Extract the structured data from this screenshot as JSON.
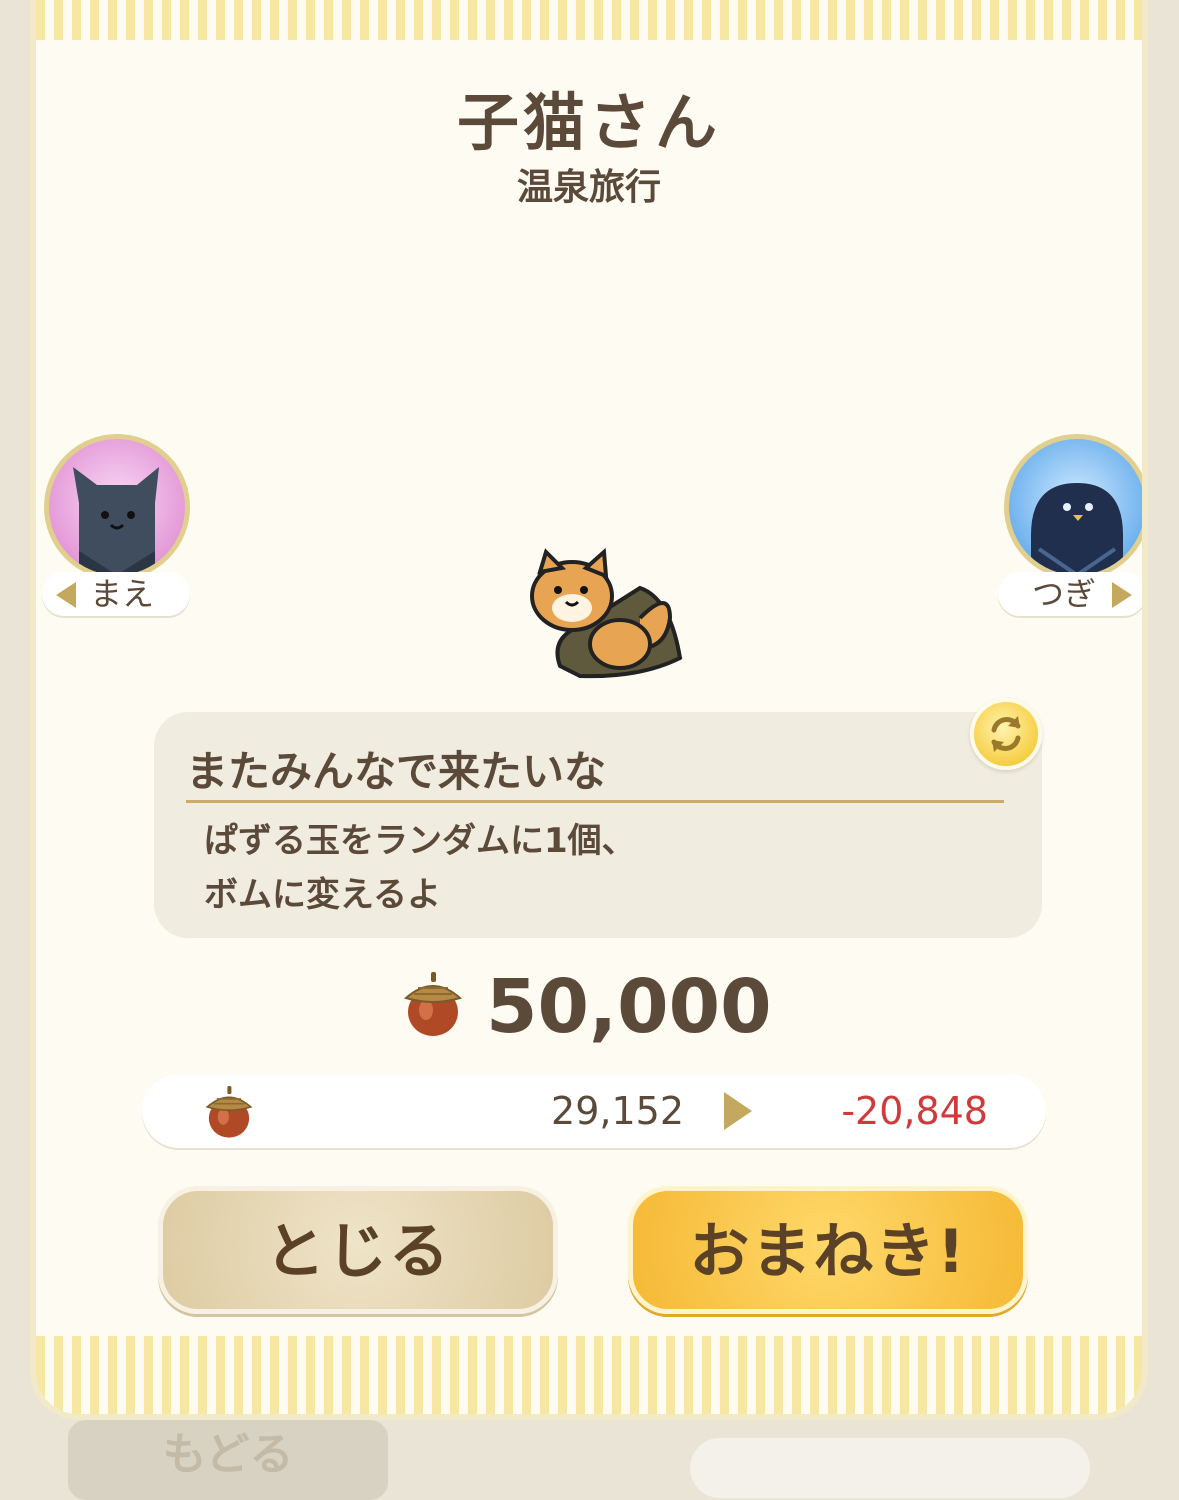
{
  "character": {
    "name": "子猫さん",
    "subtitle": "温泉旅行"
  },
  "navigation": {
    "prev_label": "まえ",
    "next_label": "つぎ"
  },
  "speech": {
    "line": "またみんなで来たいな",
    "description": "ぱずる玉をランダムに1個、\nボムに変えるよ"
  },
  "price": {
    "icon": "acorn-icon",
    "value": "50,000"
  },
  "balance": {
    "icon": "acorn-icon",
    "current": "29,152",
    "after": "-20,848",
    "after_color": "#cf3b3b"
  },
  "buttons": {
    "close_label": "とじる",
    "invite_label": "おまねき!"
  },
  "background": {
    "back_button_label": "もどる"
  },
  "colors": {
    "text_brown": "#5b4a3a",
    "stripe_yellow": "#f6e7a2",
    "invite_button": "#f5b935",
    "close_button": "#ddcba2"
  }
}
